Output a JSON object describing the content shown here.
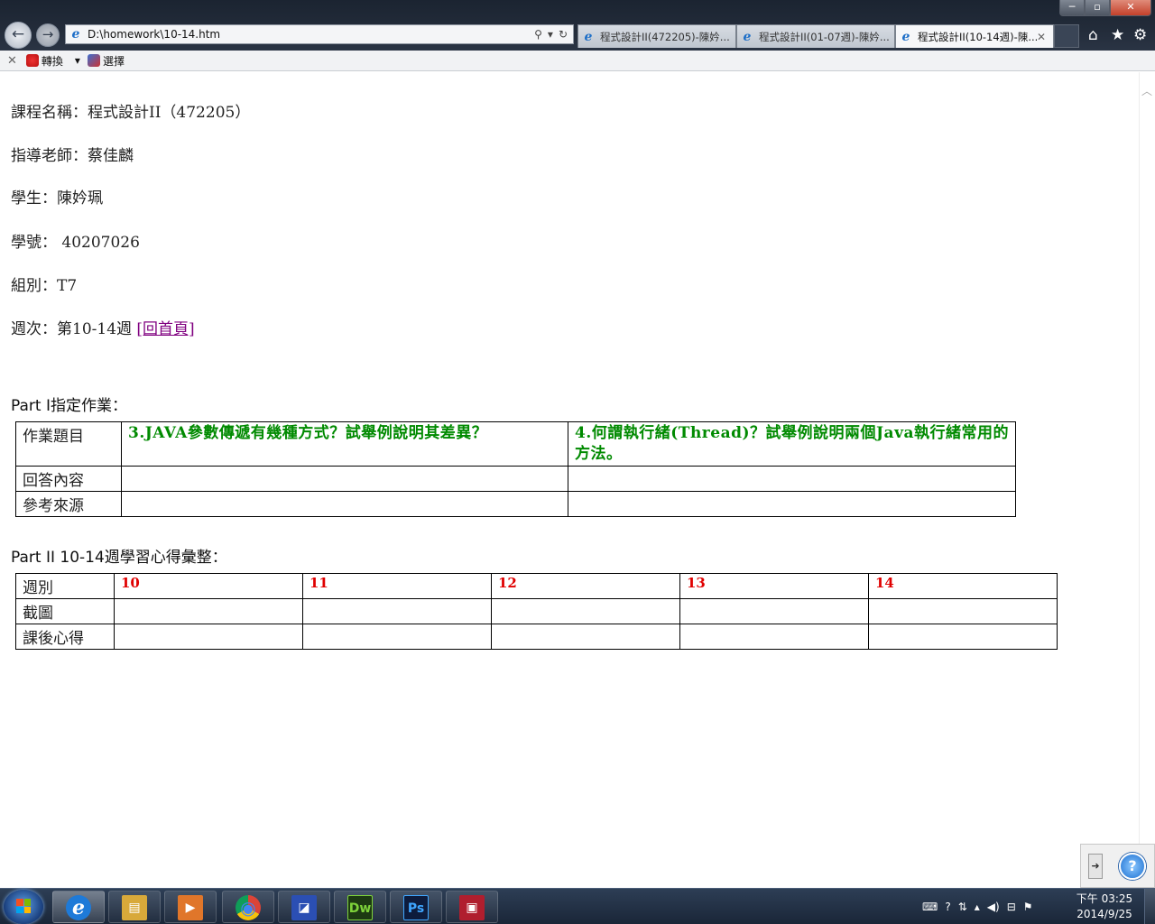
{
  "browser": {
    "window_buttons": {
      "minimize": "─",
      "maximize": "▫",
      "close": "✕"
    },
    "back_glyph": "←",
    "forward_glyph": "→",
    "address": "D:\\homework\\10-14.htm",
    "address_icons": {
      "search": "⚲",
      "dropdown": "▾",
      "refresh": "↻"
    },
    "tabs": [
      {
        "label": "程式設計II(472205)-陳妗...",
        "active": false
      },
      {
        "label": "程式設計II(01-07週)-陳妗...",
        "active": false
      },
      {
        "label": "程式設計II(10-14週)-陳...",
        "active": true
      }
    ],
    "tab_close": "✕",
    "toolbar_icons": {
      "home": "⌂",
      "favorites": "★",
      "tools": "⚙"
    },
    "command_bar": {
      "close": "✕",
      "convert": "轉換",
      "convert_arrow": "▾",
      "select": "選擇"
    }
  },
  "page": {
    "course": "課程名稱：程式設計II（472205）",
    "teacher": "指導老師：蔡佳麟",
    "student": "學生：陳妗珮",
    "student_id": "學號： 40207026",
    "group": "組別：T7",
    "week_prefix": "週次：第10-14週 ",
    "home_link": "[回首頁]",
    "part1": {
      "title_latin": "Part I",
      "title_cjk": "指定作業：",
      "row_labels": [
        "作業題目",
        "回答內容",
        "參考來源"
      ],
      "questions": [
        "3.JAVA參數傳遞有幾種方式？試舉例說明其差異？",
        "4.何謂執行緒(Thread)？試舉例說明兩個Java執行緒常用的方法。"
      ]
    },
    "part2": {
      "title_latin": "Part II 10-14",
      "title_cjk": "週學習心得彙整：",
      "row_labels": [
        "週別",
        "截圖",
        "課後心得"
      ],
      "weeks": [
        "10",
        "11",
        "12",
        "13",
        "14"
      ]
    }
  },
  "helper": {
    "arrow": "➜",
    "help": "?"
  },
  "taskbar": {
    "apps": [
      {
        "name": "internet-explorer",
        "glyph": "e",
        "color": "#1e7ad8",
        "active": true
      },
      {
        "name": "file-explorer",
        "glyph": "▤",
        "color": "#d8a93a",
        "active": false
      },
      {
        "name": "media-player",
        "glyph": "▶",
        "color": "#e0762a",
        "active": false
      },
      {
        "name": "chrome",
        "glyph": "◉",
        "color": "#d84535",
        "active": false
      },
      {
        "name": "program",
        "glyph": "◪",
        "color": "#2b4fb3",
        "active": false
      },
      {
        "name": "dreamweaver",
        "glyph": "Dw",
        "color": "#3a7d1e",
        "active": false
      },
      {
        "name": "photoshop",
        "glyph": "Ps",
        "color": "#1c3f8f",
        "active": false
      },
      {
        "name": "save-tool",
        "glyph": "▣",
        "color": "#b01e2e",
        "active": false
      }
    ],
    "tray": [
      "⌨",
      "?",
      "⇅",
      "▴",
      "◀)",
      "⊟",
      "⚑"
    ],
    "clock_time": "下午 03:25",
    "clock_date": "2014/9/25"
  }
}
